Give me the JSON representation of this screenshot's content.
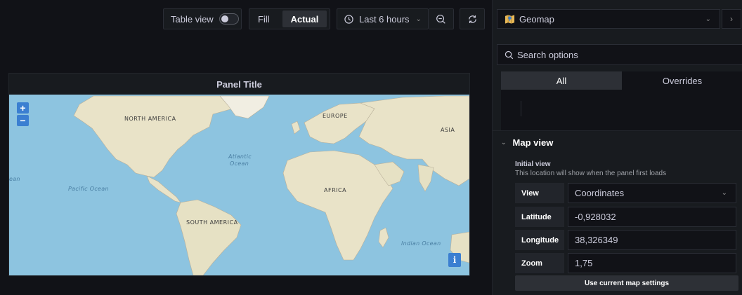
{
  "toolbar": {
    "table_view_label": "Table view",
    "fill_label": "Fill",
    "actual_label": "Actual",
    "time_range_label": "Last 6 hours"
  },
  "panel": {
    "title": "Panel Title",
    "map_labels": {
      "north_america": "NORTH AMERICA",
      "south_america": "SOUTH AMERICA",
      "europe": "EUROPE",
      "asia": "ASIA",
      "africa": "AFRICA",
      "atlantic_1": "Atlantic",
      "atlantic_2": "Ocean",
      "pacific": "Pacific Ocean",
      "indian": "Indian Ocean",
      "ocean_edge": "ean"
    },
    "zoom_in": "+",
    "zoom_out": "−",
    "info": "i"
  },
  "options": {
    "visualization": "Geomap",
    "search_placeholder": "Search options",
    "tabs": [
      {
        "label": "All",
        "active": true
      },
      {
        "label": "Overrides",
        "active": false
      }
    ],
    "section_title": "Map view",
    "initial_view_label": "Initial view",
    "initial_view_desc": "This location will show when the panel first loads",
    "fields": {
      "view": {
        "key": "View",
        "value": "Coordinates"
      },
      "latitude": {
        "key": "Latitude",
        "value": "-0,928032"
      },
      "longitude": {
        "key": "Longitude",
        "value": "38,326349"
      },
      "zoom": {
        "key": "Zoom",
        "value": "1,75"
      }
    },
    "use_map_button": "Use current map settings"
  },
  "colors": {
    "accent": "#3b7fd1",
    "ocean": "#8dc4e0",
    "land": "#e9e3c8",
    "background": "#111217",
    "panel": "#181b1f"
  }
}
